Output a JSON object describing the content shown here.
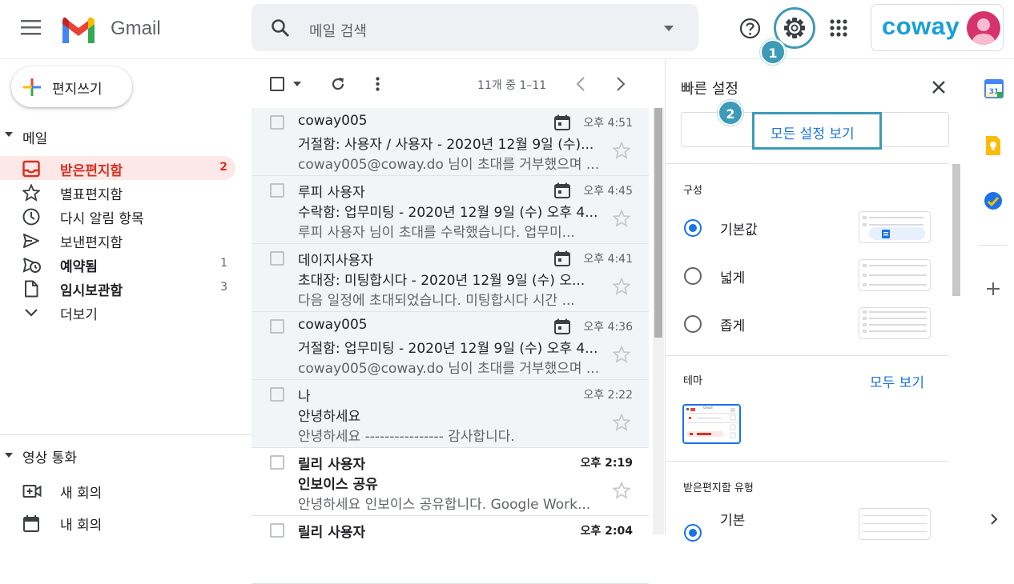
{
  "header": {
    "app_name": "Gmail",
    "search_placeholder": "메일 검색",
    "brand": "coway",
    "step_badges": [
      "1",
      "2"
    ]
  },
  "nav": {
    "compose_label": "편지쓰기",
    "section_mail": "메일",
    "items": [
      {
        "label": "받은편지함",
        "count": "2",
        "icon": "inbox-icon"
      },
      {
        "label": "별표편지함",
        "count": "",
        "icon": "star-icon"
      },
      {
        "label": "다시 알림 항목",
        "count": "",
        "icon": "clock-icon"
      },
      {
        "label": "보낸편지함",
        "count": "",
        "icon": "send-icon"
      },
      {
        "label": "예약됨",
        "count": "1",
        "icon": "scheduled-icon"
      },
      {
        "label": "임시보관함",
        "count": "3",
        "icon": "draft-icon"
      },
      {
        "label": "더보기",
        "count": "",
        "icon": "chevron-down-icon"
      }
    ],
    "section_video": "영상 통화",
    "video_items": [
      {
        "label": "새 회의",
        "icon": "video-add-icon"
      },
      {
        "label": "내 회의",
        "icon": "calendar-icon"
      }
    ]
  },
  "list": {
    "range_text": "11개 중 1–11",
    "emails": [
      {
        "sender": "coway005",
        "subject": "거절함: 사용자 / 사용자 - 2020년 12월 9일 (수)...",
        "snippet": "coway005@coway.do 님이 초대를 거부했으며 ...",
        "time": "오후 4:51",
        "calendar": true,
        "unread": false
      },
      {
        "sender": "루피 사용자",
        "subject": "수락함: 업무미팅 - 2020년 12월 9일 (수) 오후 4...",
        "snippet": "루피 사용자 님이 초대를 수락했습니다. 업무미...",
        "time": "오후 4:45",
        "calendar": true,
        "unread": false
      },
      {
        "sender": "데이지사용자",
        "subject": "초대장: 미팅합시다 - 2020년 12월 9일 (수) 오...",
        "snippet": "다음 일정에 초대되었습니다. 미팅합시다 시간 ...",
        "time": "오후 4:41",
        "calendar": true,
        "unread": false
      },
      {
        "sender": "coway005",
        "subject": "거절함: 업무미팅 - 2020년 12월 9일 (수) 오후 4...",
        "snippet": "coway005@coway.do 님이 초대를 거부했으며 ...",
        "time": "오후 4:36",
        "calendar": true,
        "unread": false
      },
      {
        "sender": "나",
        "subject": "안녕하세요",
        "snippet": "안녕하세요 ---------------- 감사합니다.",
        "time": "오후 2:22",
        "calendar": false,
        "unread": false
      },
      {
        "sender": "릴리 사용자",
        "subject": "인보이스 공유",
        "snippet": "안녕하세요 인보이스 공유합니다. Google Work...",
        "time": "오후 2:19",
        "calendar": false,
        "unread": true
      },
      {
        "sender": "릴리 사용자",
        "subject": "",
        "snippet": "",
        "time": "오후 2:04",
        "calendar": false,
        "unread": true
      }
    ]
  },
  "quick_settings": {
    "title": "빠른 설정",
    "all_settings_label": "모든 설정 보기",
    "density_label": "구성",
    "density_options": [
      "기본값",
      "넓게",
      "좁게"
    ],
    "density_selected": "기본값",
    "theme_label": "테마",
    "theme_view_all": "모두 보기",
    "theme_thumb_text": "Gmail",
    "inbox_type_label": "받은편지함 유형",
    "inbox_type_first": "기본"
  },
  "colors": {
    "accent": "#1a73e8",
    "inbox_active": "#d93025",
    "highlight": "#3d9bb8",
    "brand": "#1aa0d8"
  }
}
